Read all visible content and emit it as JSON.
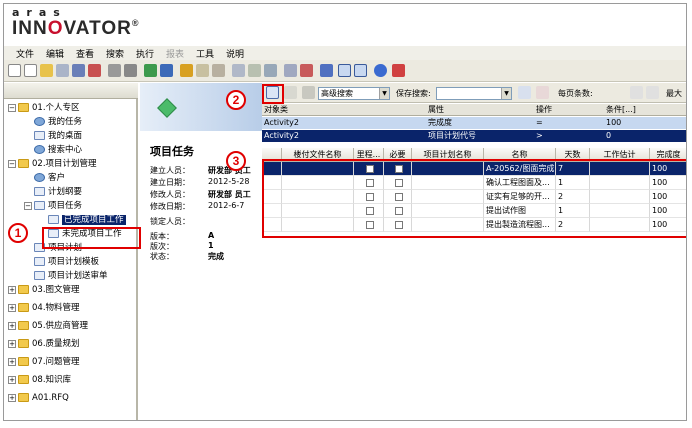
{
  "logo": {
    "small": "aras",
    "big_prefix": "INN",
    "big_o": "O",
    "big_suffix": "VATOR",
    "reg": "®"
  },
  "menu": [
    "文件",
    "编辑",
    "查看",
    "搜索",
    "执行",
    "报表",
    "工具",
    "说明"
  ],
  "tree": {
    "nodes": [
      {
        "label": "01.个人专区",
        "icon": "folder",
        "exp": "−"
      },
      {
        "label": "我的任务",
        "icon": "usr"
      },
      {
        "label": "我的桌面",
        "icon": "doc"
      },
      {
        "label": "搜索中心",
        "icon": "usr"
      },
      {
        "label": "02.项目计划管理",
        "icon": "folder",
        "exp": "−"
      },
      {
        "label": "客户",
        "icon": "usr"
      },
      {
        "label": "计划纲要",
        "icon": "doc"
      },
      {
        "label": "项目任务",
        "icon": "doc",
        "exp": "−"
      },
      {
        "label": "已完成项目工作",
        "icon": "doc"
      },
      {
        "label": "未完成项目工作",
        "icon": "doc"
      },
      {
        "label": "项目计划",
        "icon": "doc"
      },
      {
        "label": "项目计划模板",
        "icon": "doc"
      },
      {
        "label": "项目计划送审单",
        "icon": "doc"
      },
      {
        "label": "03.图文管理",
        "icon": "folder",
        "exp": "+"
      },
      {
        "label": "04.物料管理",
        "icon": "folder",
        "exp": "+"
      },
      {
        "label": "05.供应商管理",
        "icon": "folder",
        "exp": "+"
      },
      {
        "label": "06.质量规划",
        "icon": "folder",
        "exp": "+"
      },
      {
        "label": "07.问题管理",
        "icon": "folder",
        "exp": "+"
      },
      {
        "label": "08.知识库",
        "icon": "folder",
        "exp": "+"
      },
      {
        "label": "A01.RFQ",
        "icon": "folder",
        "exp": "+"
      }
    ]
  },
  "form": {
    "title": "项目任务",
    "fields": [
      {
        "label": "建立人员：",
        "value": "研发部 员工"
      },
      {
        "label": "建立日期：",
        "value": "2012-5-28"
      },
      {
        "label": "修改人员：",
        "value": "研发部 员工"
      },
      {
        "label": "修改日期：",
        "value": "2012-6-7"
      },
      {
        "label": "锁定人员：",
        "value": ""
      },
      {
        "label": "版本：",
        "value": "A"
      },
      {
        "label": "版次：",
        "value": "1"
      },
      {
        "label": "状态：",
        "value": "完成"
      }
    ]
  },
  "grid_toolbar": {
    "search_mode": "高级搜索",
    "saved_search_label": "保存搜索:",
    "saved_search_value": "",
    "page_size_label": "每页条数:",
    "max_label": "最大"
  },
  "query": {
    "headers": [
      "对象类",
      "属性",
      "操作",
      "条件[...]"
    ],
    "rows": [
      [
        "Activity2",
        "完成度",
        "=",
        "100"
      ],
      [
        "Activity2",
        "项目计划代号",
        ">",
        "0"
      ]
    ]
  },
  "table": {
    "headers": [
      "",
      "楼付文件名称",
      "里程...",
      "必要",
      "项目计划名称",
      "名称",
      "天数",
      "工作估计",
      "完成度"
    ],
    "rows": [
      {
        "name": "A-20562/图面完成",
        "days": "7",
        "done": "100"
      },
      {
        "name": "确认工程图面及...",
        "days": "1",
        "done": "100"
      },
      {
        "name": "证实有足够的开...",
        "days": "2",
        "done": "100"
      },
      {
        "name": "提出试作图",
        "days": "1",
        "done": "100"
      },
      {
        "name": "提出製造流程图...",
        "days": "2",
        "done": "100"
      }
    ]
  },
  "callouts": [
    "1",
    "2",
    "3"
  ]
}
